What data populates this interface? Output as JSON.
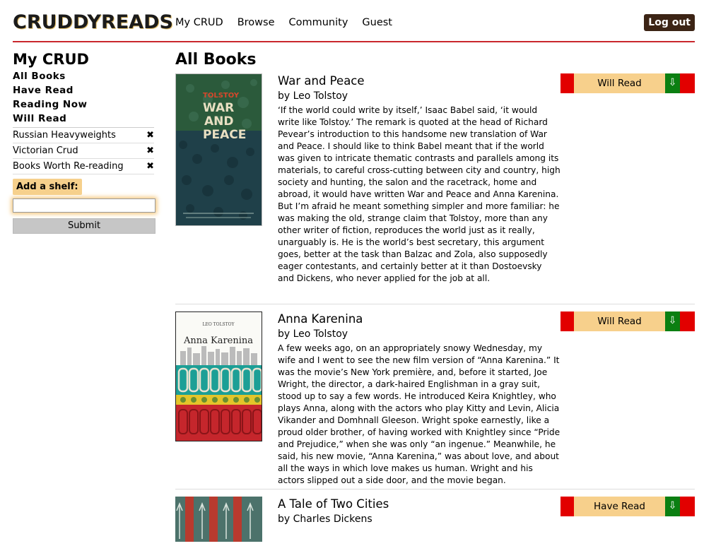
{
  "brand": {
    "logo": "CRUDDYREADS"
  },
  "nav": {
    "items": [
      "My CRUD",
      "Browse",
      "Community",
      "Guest"
    ],
    "logout": "Log out"
  },
  "sidebar": {
    "title": "My CRUD",
    "shelves": [
      "All Books",
      "Have Read",
      "Reading Now",
      "Will Read"
    ],
    "custom_shelves": [
      {
        "name": "Russian Heavyweights",
        "delete": "✖"
      },
      {
        "name": "Victorian Crud",
        "delete": "✖"
      },
      {
        "name": "Books Worth Re-reading",
        "delete": "✖"
      }
    ],
    "add_shelf_label": "Add a shelf:",
    "add_shelf_value": "",
    "submit": "Submit"
  },
  "main": {
    "title": "All Books",
    "books": [
      {
        "title": "War and Peace",
        "author": "by Leo Tolstoy",
        "description": "‘If the world could write by itself,’ Isaac Babel said, ‘it would write like Tolstoy.’ The remark is quoted at the head of Richard Pevear’s introduction to this handsome new translation of War and Peace. I should like to think Babel meant that if the world was given to intricate thematic contrasts and parallels among its materials, to careful cross-cutting between city and country, high society and hunting, the salon and the racetrack, home and abroad, it would have written War and Peace and Anna Karenina. But I’m afraid he meant something simpler and more familiar: he was making the old, strange claim that Tolstoy, more than any other writer of fiction, reproduces the world just as it really, unarguably is. He is the world’s best secretary, this argument goes, better at the task than Balzac and Zola, also supposedly eager contestants, and certainly better at it than Dostoevsky and Dickens, who never applied for the job at all.",
        "status": "Will Read",
        "cover_text": {
          "author": "TOLSTOY",
          "title": [
            "WAR",
            "AND",
            "PEACE"
          ]
        }
      },
      {
        "title": "Anna Karenina",
        "author": "by Leo Tolstoy",
        "description": "A few weeks ago, on an appropriately snowy Wednesday, my wife and I went to see the new film version of “Anna Karenina.” It was the movie’s New York première, and, before it started, Joe Wright, the director, a dark-haired Englishman in a gray suit, stood up to say a few words. He introduced Keira Knightley, who plays Anna, along with the actors who play Kitty and Levin, Alicia Vikander and Domhnall Gleeson. Wright spoke earnestly, like a proud older brother, of having worked with Knightley since “Pride and Prejudice,” when she was only “an ingenue.” Meanwhile, he said, his new movie, “Anna Karenina,” was about love, and about all the ways in which love makes us human. Wright and his actors slipped out a side door, and the movie began.",
        "status": "Will Read",
        "cover_text": {
          "author": "LEO TOLSTOY",
          "title": "Anna Karenina"
        }
      },
      {
        "title": "A Tale of Two Cities",
        "author": "by Charles Dickens",
        "description": "",
        "status": "Have Read"
      }
    ]
  },
  "colors": {
    "accent_red": "#e20000",
    "status_bg": "#f7d08c",
    "arrow_green": "#0b7f12",
    "logout_bg": "#3c2415",
    "header_rule": "#c9272d"
  },
  "icons": {
    "delete": "close-icon",
    "status_arrow": "arrow-down-icon"
  }
}
